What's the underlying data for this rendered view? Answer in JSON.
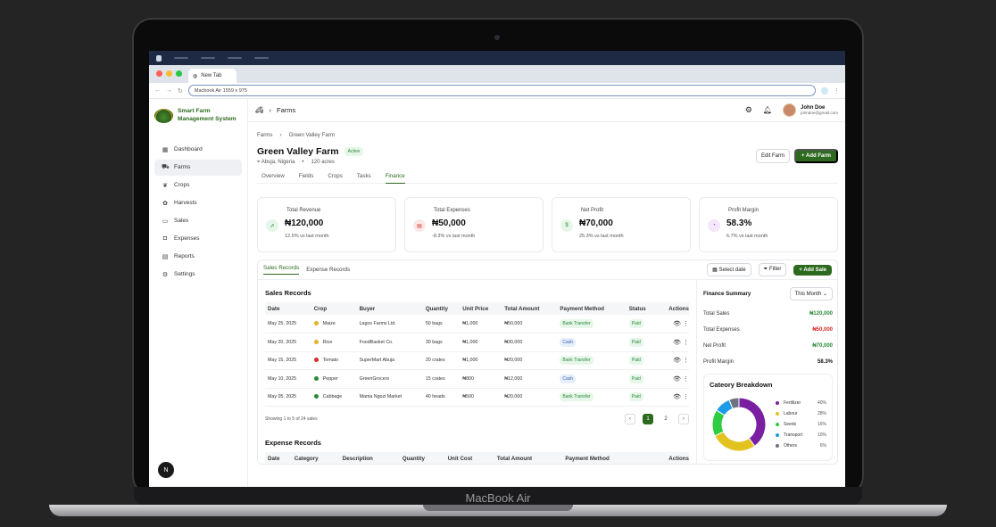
{
  "device": {
    "brand_label": "MacBook Air"
  },
  "browser": {
    "tab_title": "New Tab",
    "url": "Macbook Air  1559 x 975"
  },
  "colors": {
    "brand_green": "#2d6a1f",
    "positive": "#2a8a3a",
    "negative": "#d92b2b"
  },
  "sidebar": {
    "logo_text_line1": "Smart Farm",
    "logo_text_line2": "Management System",
    "items": [
      {
        "label": "Dashboard",
        "icon": "dashboard-icon"
      },
      {
        "label": "Farms",
        "icon": "tractor-icon"
      },
      {
        "label": "Crops",
        "icon": "sprout-icon"
      },
      {
        "label": "Harvests",
        "icon": "harvest-icon"
      },
      {
        "label": "Sales",
        "icon": "money-icon"
      },
      {
        "label": "Expenses",
        "icon": "wallet-icon"
      },
      {
        "label": "Reports",
        "icon": "report-icon"
      },
      {
        "label": "Settings",
        "icon": "gear-icon"
      }
    ],
    "avatar_letter": "N"
  },
  "topbar": {
    "section": "Farms",
    "user_name": "John Doe",
    "user_email": "johndoe@gmail.com"
  },
  "breadcrumb": {
    "root": "Farms",
    "current": "Green Valley Farm"
  },
  "farm": {
    "title": "Green Valley Farm",
    "status": "Active",
    "location": "Abuja, Nigeria",
    "size": "120 acres",
    "edit_label": "Edit Farm",
    "add_label": "Add Farm"
  },
  "subtabs": [
    "Overview",
    "Fields",
    "Crops",
    "Tasks",
    "Finance"
  ],
  "stats": [
    {
      "label": "Total Revenue",
      "value": "₦120,000",
      "change": "12.5% vs last month",
      "icon": "revenue-icon",
      "bg": "#e6f6e9",
      "fg": "#2a8a3a"
    },
    {
      "label": "Total Expenses",
      "value": "₦50,000",
      "change": "-8.3% vs last month",
      "icon": "expense-icon",
      "bg": "#fde8e8",
      "fg": "#d92b2b"
    },
    {
      "label": "Net Profit",
      "value": "₦70,000",
      "change": "25.3% vs last month",
      "icon": "profit-icon",
      "bg": "#e6f6e9",
      "fg": "#2a8a3a"
    },
    {
      "label": "Profit Margin",
      "value": "58.3%",
      "change": "6.7% vs last month",
      "icon": "margin-icon",
      "bg": "#f4e6fb",
      "fg": "#9a3ac0"
    }
  ],
  "records": {
    "tab_sales": "Sales Records",
    "tab_expense": "Expense Records",
    "select_date": "Select date",
    "filter": "Filter",
    "add_sale": "Add Sale",
    "sales_title": "Sales Records",
    "columns": [
      "Date",
      "Crop",
      "Buyer",
      "Quantity",
      "Unit Price",
      "Total Amount",
      "Payment Method",
      "Status",
      "Actions"
    ],
    "rows": [
      {
        "date": "May 25, 2025",
        "crop": "Maize",
        "crop_color": "#e2b227",
        "buyer": "Lagos Farms Ltd.",
        "qty": "50 bags",
        "unit": "₦1,000",
        "total": "₦50,000",
        "method": "Bank Transfer",
        "method_type": "bank",
        "status": "Paid"
      },
      {
        "date": "May 20, 2025",
        "crop": "Rice",
        "crop_color": "#e2b227",
        "buyer": "FoodBasket Co.",
        "qty": "30 bags",
        "unit": "₦1,000",
        "total": "₦30,000",
        "method": "Cash",
        "method_type": "cash",
        "status": "Paid"
      },
      {
        "date": "May 15, 2025",
        "crop": "Tomato",
        "crop_color": "#d92b2b",
        "buyer": "SuperMart Abuja",
        "qty": "20 crates",
        "unit": "₦1,000",
        "total": "₦20,000",
        "method": "Bank Transfer",
        "method_type": "bank",
        "status": "Paid"
      },
      {
        "date": "May 10, 2025",
        "crop": "Pepper",
        "crop_color": "#2a8a3a",
        "buyer": "GreenGrocers",
        "qty": "15 crates",
        "unit": "₦800",
        "total": "₦12,000",
        "method": "Cash",
        "method_type": "cash",
        "status": "Paid"
      },
      {
        "date": "May 05, 2025",
        "crop": "Cabbage",
        "crop_color": "#2a8a3a",
        "buyer": "Mama Ngozi Market",
        "qty": "40 heads",
        "unit": "₦500",
        "total": "₦20,000",
        "method": "Bank Transfer",
        "method_type": "bank",
        "status": "Paid"
      }
    ],
    "showing": "Showing 1 to 5 of 24 sales",
    "pages": [
      "1",
      "2"
    ],
    "expense_title": "Expense Records",
    "expense_columns": [
      "Date",
      "Category",
      "Description",
      "Quantity",
      "Unit Cost",
      "Total Amount",
      "Payment Method",
      "Actions"
    ]
  },
  "finance_summary": {
    "title": "Finance Summary",
    "period": "This Month",
    "rows": [
      {
        "label": "Total Sales",
        "value": "₦120,000",
        "color": "#2a8a3a"
      },
      {
        "label": "Total Expenses",
        "value": "₦50,000",
        "color": "#d92b2b"
      },
      {
        "label": "Net Profit",
        "value": "₦70,000",
        "color": "#2a8a3a"
      },
      {
        "label": "Profit Margin",
        "value": "58.3%",
        "color": "#111111"
      }
    ]
  },
  "chart_data": {
    "type": "pie",
    "title": "Cateory Breakdown",
    "categories": [
      "Fertilizer",
      "Labour",
      "Seeds",
      "Transport",
      "Others"
    ],
    "values": [
      40,
      28,
      16,
      10,
      6
    ],
    "labels": [
      "40%",
      "28%",
      "16%",
      "10%",
      "6%"
    ],
    "colors": [
      "#7b1fa2",
      "#e2c21f",
      "#2ecc40",
      "#1e9be6",
      "#6b7280"
    ]
  }
}
